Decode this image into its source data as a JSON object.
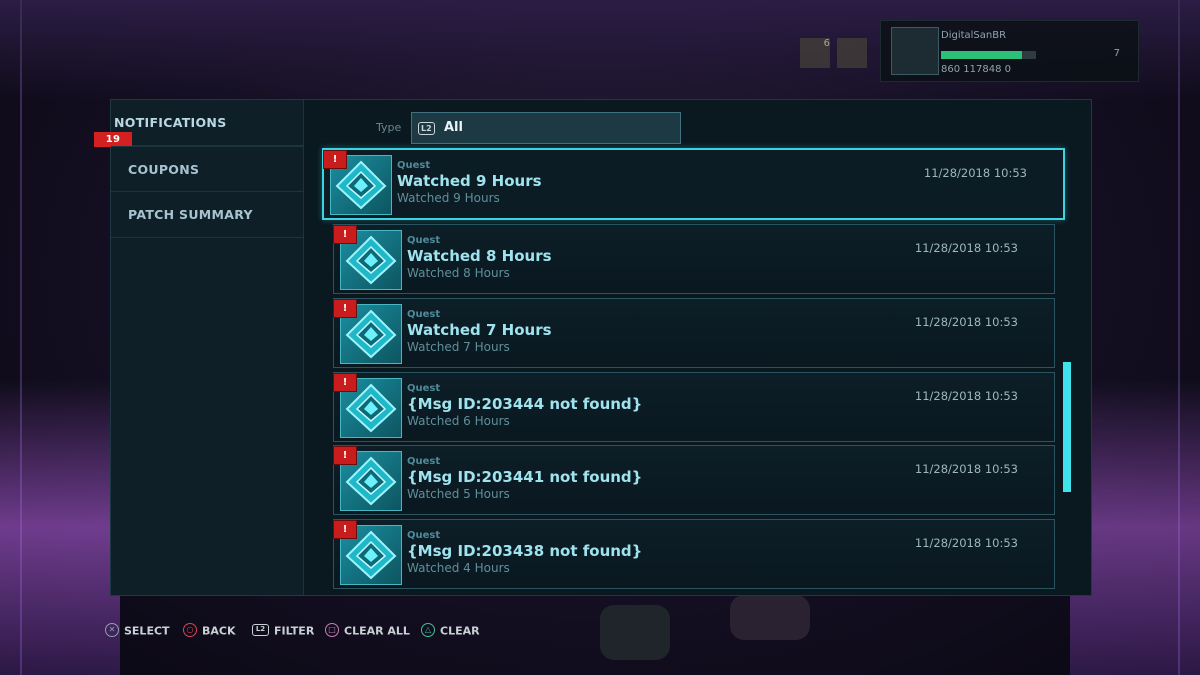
{
  "player": {
    "name": "DigitalSanBR",
    "level": "7",
    "xp_fraction": 0.85,
    "currency": "860  117848  0",
    "top_icon_count": "6"
  },
  "sidebar": {
    "items": [
      {
        "label": "NOTIFICATIONS",
        "active": true,
        "badge": "19"
      },
      {
        "label": "COUPONS",
        "active": false
      },
      {
        "label": "PATCH SUMMARY",
        "active": false
      }
    ]
  },
  "filter": {
    "label": "Type",
    "button_glyph": "L2",
    "value": "All"
  },
  "notifications": [
    {
      "category": "Quest",
      "title": "Watched 9 Hours",
      "subtitle": "Watched 9 Hours",
      "date": "11/28/2018 10:53",
      "alert": "!",
      "selected": true
    },
    {
      "category": "Quest",
      "title": "Watched 8 Hours",
      "subtitle": "Watched 8 Hours",
      "date": "11/28/2018 10:53",
      "alert": "!",
      "selected": false
    },
    {
      "category": "Quest",
      "title": "Watched 7 Hours",
      "subtitle": "Watched 7 Hours",
      "date": "11/28/2018 10:53",
      "alert": "!",
      "selected": false
    },
    {
      "category": "Quest",
      "title": "{Msg ID:203444 not found}",
      "subtitle": "Watched 6 Hours",
      "date": "11/28/2018 10:53",
      "alert": "!",
      "selected": false
    },
    {
      "category": "Quest",
      "title": "{Msg ID:203441 not found}",
      "subtitle": "Watched 5 Hours",
      "date": "11/28/2018 10:53",
      "alert": "!",
      "selected": false
    },
    {
      "category": "Quest",
      "title": "{Msg ID:203438 not found}",
      "subtitle": "Watched 4 Hours",
      "date": "11/28/2018 10:53",
      "alert": "!",
      "selected": false
    }
  ],
  "controls": [
    {
      "glyph": "cross-icon",
      "label": "SELECT",
      "color": "#8aa0b0"
    },
    {
      "glyph": "circle-icon",
      "label": "BACK",
      "color": "#d9454f"
    },
    {
      "glyph": "L2",
      "label": "FILTER",
      "color": "#c7d1d6"
    },
    {
      "glyph": "square-icon",
      "label": "CLEAR ALL",
      "color": "#c77fb3"
    },
    {
      "glyph": "triangle-icon",
      "label": "CLEAR",
      "color": "#3fbf9a"
    }
  ],
  "colors": {
    "accent": "#3fd3df",
    "alert": "#c91d1d",
    "panel": "#0a1820"
  }
}
